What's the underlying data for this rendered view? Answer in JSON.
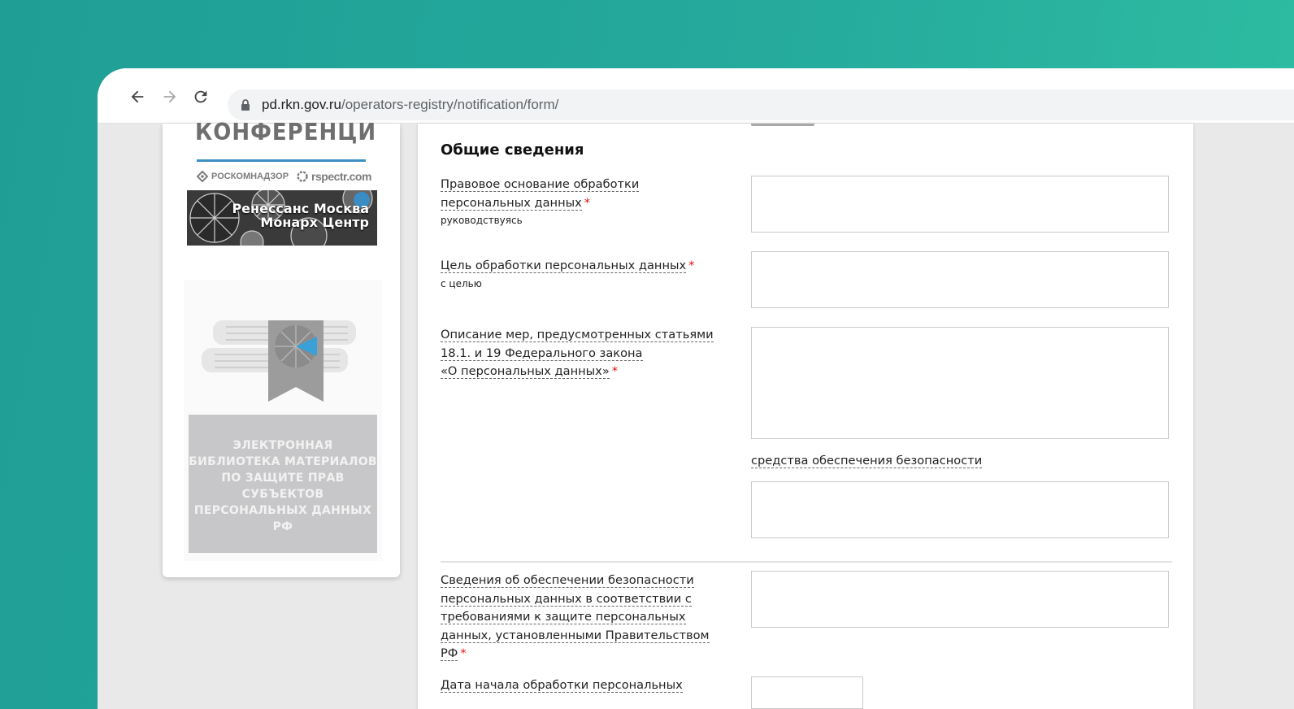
{
  "browser": {
    "url_host": "pd.rkn.gov.ru",
    "url_path": "/operators-registry/notification/form/",
    "back_icon": "arrow-left-icon",
    "forward_icon": "arrow-right-icon",
    "reload_icon": "reload-icon",
    "lock_icon": "lock-icon"
  },
  "sidebar": {
    "conference_title": "КОНФЕРЕНЦИЯ",
    "logos": [
      "РОСКОМНАДЗОР",
      "rspectr.com"
    ],
    "venue_line1": "Ренессанс Москва",
    "venue_line2": "Монарх Центр",
    "library_text": "ЭЛЕКТРОННАЯ БИБЛИОТЕКА МАТЕРИАЛОВ ПО ЗАЩИТЕ ПРАВ СУБЪЕКТОВ ПЕРСОНАЛЬНЫХ ДАННЫХ РФ"
  },
  "form": {
    "section_title": "Общие сведения",
    "required_mark": "*",
    "fields": [
      {
        "label_line1": "Правовое основание обработки",
        "label_line2": "персональных данных",
        "hint": "руководствуясь",
        "value": ""
      },
      {
        "label_line1": "Цель обработки персональных данных",
        "hint": "с целью",
        "value": ""
      },
      {
        "label_line1": "Описание мер, предусмотренных статьями",
        "label_line2": "18.1. и 19 Федерального закона",
        "label_line3": "«О персональных данных»",
        "value": ""
      },
      {
        "sub_label": "средства обеспечения безопасности",
        "value": ""
      },
      {
        "label_line1": "Сведения об обеспечении безопасности",
        "label_line2": "персональных данных в соответствии с",
        "label_line3": "требованиями к защите персональных",
        "label_line4": "данных, установленными Правительством",
        "label_line5": "РФ",
        "value": ""
      },
      {
        "label_line1": "Дата начала обработки персональных",
        "value": ""
      }
    ]
  }
}
